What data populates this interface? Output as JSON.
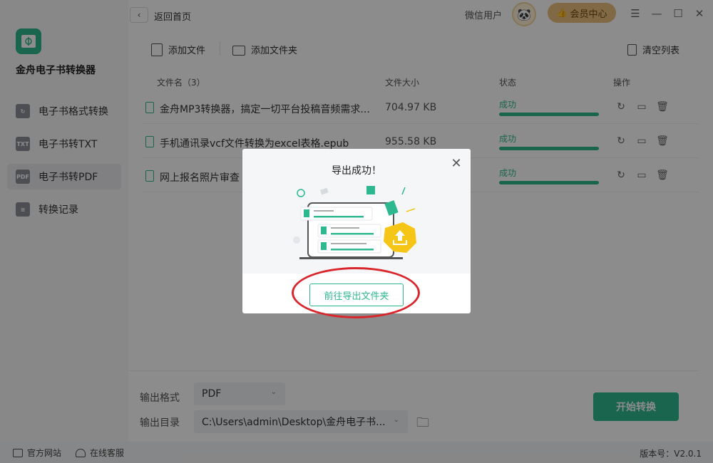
{
  "app": {
    "name": "金舟电子书转换器"
  },
  "sidebar": {
    "items": [
      {
        "label": "电子书格式转换",
        "icon": "refresh-icon",
        "badge": "",
        "active": false
      },
      {
        "label": "电子书转TXT",
        "icon": "txt-icon",
        "badge": "TXT",
        "active": false
      },
      {
        "label": "电子书转PDF",
        "icon": "pdf-icon",
        "badge": "PDF",
        "active": true
      },
      {
        "label": "转换记录",
        "icon": "list-icon",
        "badge": "",
        "active": false
      }
    ]
  },
  "topbar": {
    "back_label": "返回首页",
    "back_icon": "‹",
    "user_name": "微信用户",
    "vip_label": "会员中心",
    "vip_icon": "👍",
    "menu_icon": "☰",
    "min_icon": "—",
    "max_icon": "☐",
    "close_icon": "✕"
  },
  "toolbar": {
    "add_file": "添加文件",
    "add_folder": "添加文件夹",
    "clear_list": "清空列表"
  },
  "table": {
    "headers": [
      "文件名（3）",
      "文件大小",
      "状态",
      "操作"
    ],
    "rows": [
      {
        "name": "金舟MP3转换器，搞定一切平台投稿音频需求...",
        "size": "704.97 KB",
        "status": "成功"
      },
      {
        "name": "手机通讯录vcf文件转换为excel表格.epub",
        "size": "955.58 KB",
        "status": "成功"
      },
      {
        "name": "网上报名照片审查",
        "size": "",
        "status": "成功"
      }
    ],
    "op_icons": [
      "↻",
      "▭",
      "🗑"
    ]
  },
  "bottom": {
    "format_label": "输出格式",
    "format_value": "PDF",
    "dir_label": "输出目录",
    "dir_value": "C:\\Users\\admin\\Desktop\\金舟电子书...",
    "start_label": "开始转换",
    "chevron": "⌄",
    "folder_icon": "🗀"
  },
  "statusbar": {
    "site": "官方网站",
    "service": "在线客服",
    "version": "版本号：V2.0.1"
  },
  "dialog": {
    "title": "导出成功！",
    "close_icon": "✕",
    "button": "前往导出文件夹"
  },
  "colors": {
    "accent": "#2eb88f",
    "vip": "#e9c07c",
    "highlight": "#d9262c"
  }
}
